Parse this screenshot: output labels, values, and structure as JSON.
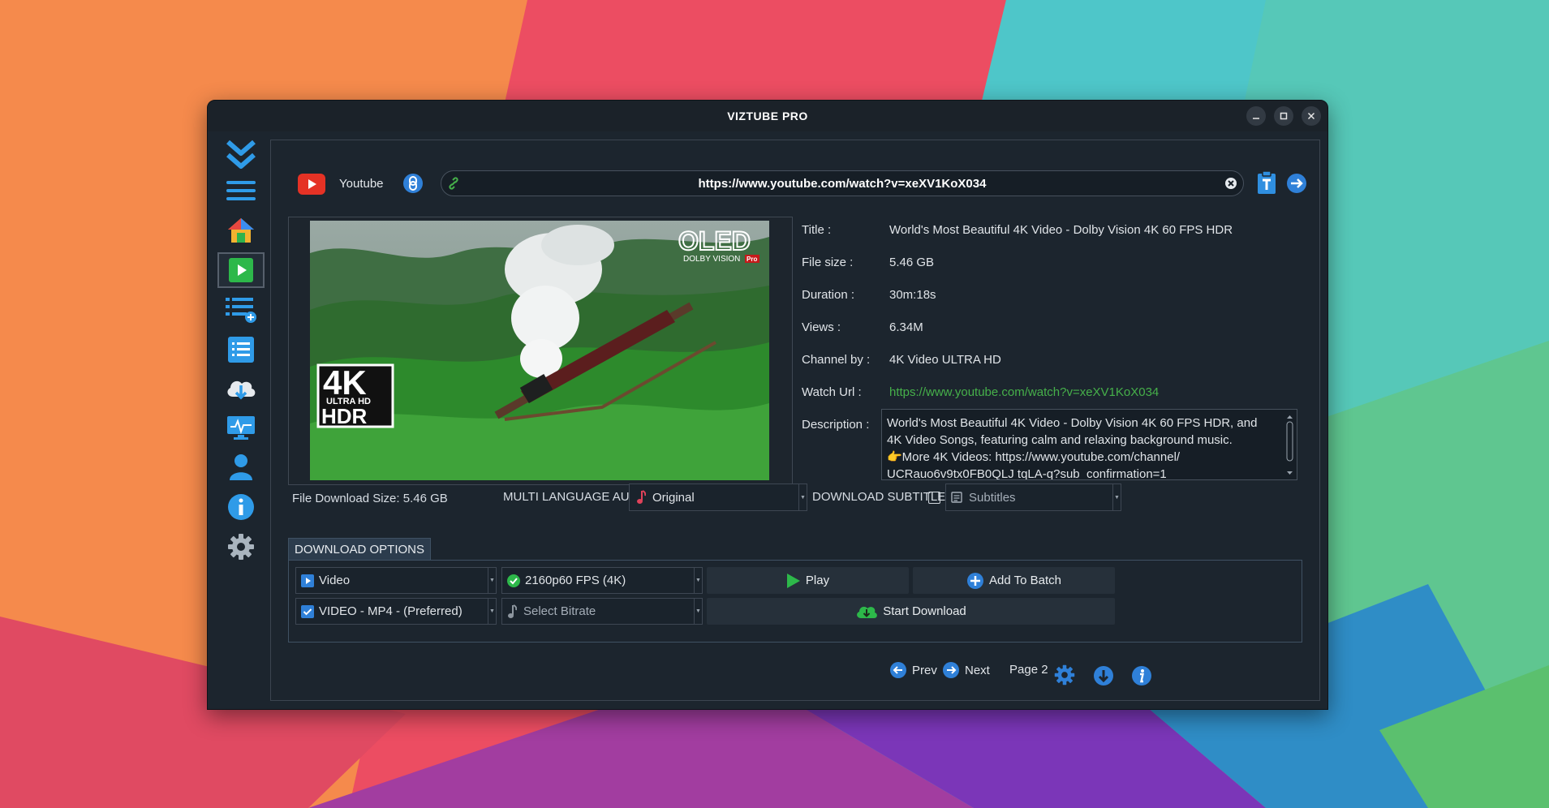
{
  "window": {
    "title": "VIZTUBE PRO"
  },
  "window_controls": [
    "minimize",
    "maximize",
    "close"
  ],
  "sidebar": {
    "items": [
      {
        "name": "logo-chevrons-icon"
      },
      {
        "name": "menu-icon"
      },
      {
        "name": "home-icon"
      },
      {
        "name": "play-icon",
        "active": true
      },
      {
        "name": "playlist-add-icon"
      },
      {
        "name": "list-icon"
      },
      {
        "name": "cloud-download-icon"
      },
      {
        "name": "monitor-icon"
      },
      {
        "name": "user-icon"
      },
      {
        "name": "info-icon"
      },
      {
        "name": "settings-icon"
      }
    ]
  },
  "source": {
    "label": "Youtube"
  },
  "url_bar": {
    "value": "https://www.youtube.com/watch?v=xeXV1KoX034"
  },
  "thumbnail": {
    "badge_top": "OLED",
    "badge_top_sub": "DOLBY VISION",
    "badge_top_pro": "Pro",
    "badge_4k": "4K",
    "badge_uhd": "ULTRA HD",
    "badge_hdr": "HDR"
  },
  "info": {
    "title_key": "Title :",
    "title_val": "World's Most Beautiful 4K Video - Dolby Vision 4K 60 FPS HDR",
    "size_key": "File size :",
    "size_val": "5.46 GB",
    "duration_key": "Duration :",
    "duration_val": "30m:18s",
    "views_key": "Views :",
    "views_val": "6.34M",
    "channel_key": "Channel by :",
    "channel_val": "4K Video ULTRA HD",
    "url_key": "Watch Url :",
    "url_val": "https://www.youtube.com/watch?v=xeXV1KoX034",
    "desc_key": "Description :",
    "desc_line1": "World's Most Beautiful 4K Video - Dolby Vision 4K 60 FPS HDR, and",
    "desc_line2": "4K Video Songs, featuring calm and relaxing background music.",
    "desc_line3": "👉More 4K Videos: https://www.youtube.com/channel/",
    "desc_line4": "UCRauo6v9tx0FB0QLJ tqLA-q?sub_confirmation=1"
  },
  "options": {
    "file_size_label": "File Download Size: 5.46 GB",
    "audio_label": "MULTI LANGUAGE AUDIO",
    "audio_value": "Original",
    "subtitles_label": "DOWNLOAD SUBTITLES",
    "subtitles_checked": false,
    "subtitles_placeholder": "Subtitles"
  },
  "download_options": {
    "tab_label": "DOWNLOAD OPTIONS",
    "type_value": "Video",
    "quality_value": "2160p60 FPS (4K)",
    "format_value": "VIDEO - MP4 - (Preferred)",
    "bitrate_placeholder": "Select Bitrate",
    "play_label": "Play",
    "batch_label": "Add To Batch",
    "start_label": "Start Download"
  },
  "pager": {
    "prev_label": "Prev",
    "next_label": "Next",
    "page_label": "Page 2"
  },
  "colors": {
    "window_bg": "#1c252e",
    "accent_blue": "#2f8fe0",
    "link_green": "#46b04a",
    "youtube_red": "#e53225",
    "play_green": "#2db84a"
  }
}
